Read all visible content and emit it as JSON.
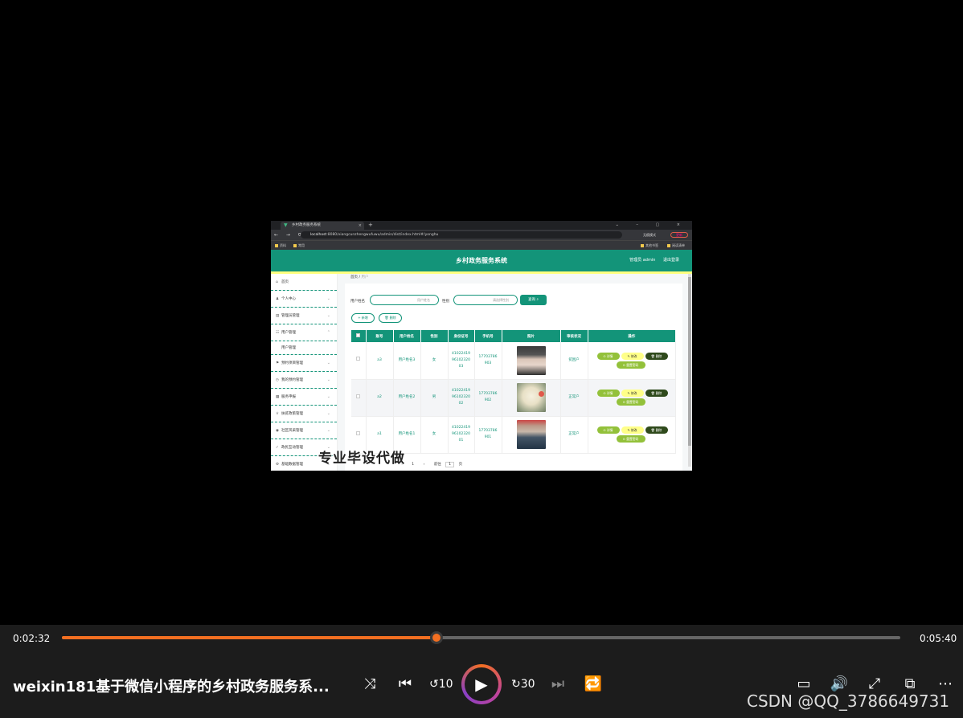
{
  "browser": {
    "tab_title": "乡村政务服务系统",
    "url_host": "localhost",
    "url_rest": ":8080/xiangcunzhengwufuwu/admin/dist/index.html#/yonghu",
    "incognito": "无痕模式",
    "update": "更新",
    "bookmarks": [
      "资料",
      "常用"
    ],
    "bookmarks_right": [
      "其他书签",
      "阅读清单"
    ]
  },
  "app": {
    "title": "乡村政务服务系统",
    "user": "管理员 admin",
    "logout": "退出登录"
  },
  "sidebar": [
    {
      "icon": "home-icon",
      "label": "首页",
      "glyph": "⌂",
      "arrow": ""
    },
    {
      "icon": "user-icon",
      "label": "个人中心",
      "glyph": "♟",
      "arrow": "⌄"
    },
    {
      "icon": "admin-icon",
      "label": "管理员管理",
      "glyph": "▤",
      "arrow": "⌄"
    },
    {
      "icon": "users-icon",
      "label": "用户管理",
      "glyph": "☷",
      "arrow": "⌃"
    },
    {
      "icon": "flag-icon",
      "label": "预约项目管理",
      "glyph": "⚑",
      "arrow": "⌄"
    },
    {
      "icon": "clock-icon",
      "label": "我的预约管理",
      "glyph": "◷",
      "arrow": "⌄"
    },
    {
      "icon": "doc-icon",
      "label": "服务申报",
      "glyph": "▦",
      "arrow": "⌄"
    },
    {
      "icon": "award-icon",
      "label": "扶贫政策管理",
      "glyph": "♕",
      "arrow": "⌄"
    },
    {
      "icon": "location-icon",
      "label": "社区风采管理",
      "glyph": "◉",
      "arrow": "⌄"
    },
    {
      "icon": "check-icon",
      "label": "政民互动管理",
      "glyph": "✓",
      "arrow": "⌄"
    },
    {
      "icon": "settings-icon",
      "label": "基础数据管理",
      "glyph": "⚙",
      "arrow": "⌄"
    }
  ],
  "sidebar_sub": "用户管理",
  "breadcrumb": {
    "home": "首页",
    "sep": "/",
    "current": "用户"
  },
  "search": {
    "name_label": "用户姓名",
    "name_placeholder": "用户姓名",
    "gender_label": "性别",
    "gender_placeholder": "请选择性别",
    "query": "查询 ⌕",
    "add": "+ 新增",
    "delete": "🗑 删除"
  },
  "table": {
    "headers": [
      "",
      "账号",
      "用户姓名",
      "性别",
      "身份证号",
      "手机号",
      "照片",
      "审核状况",
      "操作"
    ],
    "rows": [
      {
        "account": "a3",
        "name": "用户姓名3",
        "gender": "女",
        "idcard": "410224199610232003",
        "phone": "17703786903",
        "status": "贫困户"
      },
      {
        "account": "a2",
        "name": "用户姓名2",
        "gender": "男",
        "idcard": "410224199610232002",
        "phone": "17703786902",
        "status": "正常户"
      },
      {
        "account": "a1",
        "name": "用户姓名1",
        "gender": "女",
        "idcard": "410224199610232001",
        "phone": "17703786901",
        "status": "正常户"
      }
    ],
    "ops": {
      "detail": "⊙ 详情",
      "edit": "✎ 修改",
      "delete": "🗑 删除",
      "reset": "⊙ 重置密码"
    }
  },
  "pager": {
    "page": "1",
    "goto": "前往",
    "page_unit": "页"
  },
  "overlay_caption": "专业毕设代做",
  "player": {
    "current_time": "0:02:32",
    "duration": "0:05:40",
    "progress": 0.4469,
    "title": "weixin181基于微信小程序的乡村政务服务系...",
    "watermark": "CSDN @QQ_3786649731",
    "accent": "#f36f21"
  }
}
